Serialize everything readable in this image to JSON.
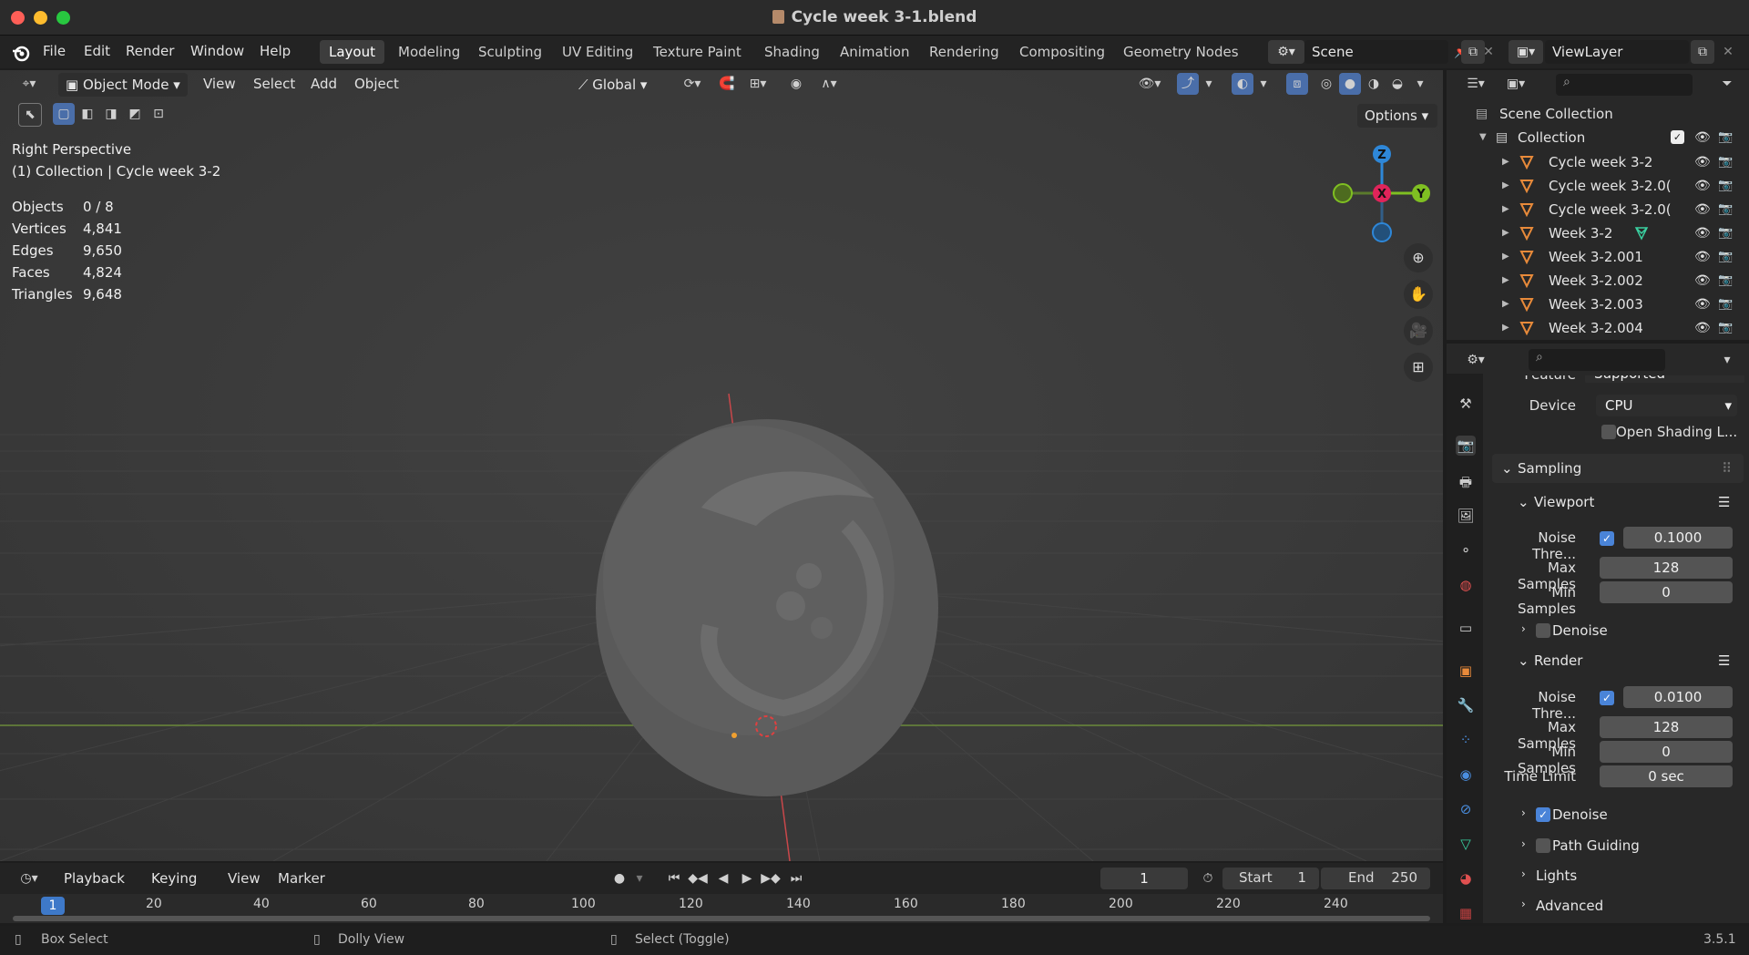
{
  "window": {
    "title": "Cycle week 3-1.blend"
  },
  "menubar": {
    "items": [
      "File",
      "Edit",
      "Render",
      "Window",
      "Help"
    ]
  },
  "workspaces": {
    "tabs": [
      "Layout",
      "Modeling",
      "Sculpting",
      "UV Editing",
      "Texture Paint",
      "Shading",
      "Animation",
      "Rendering",
      "Compositing",
      "Geometry Nodes"
    ],
    "active": "Layout"
  },
  "scene": {
    "name": "Scene",
    "view_layer": "ViewLayer"
  },
  "viewport_header": {
    "mode": "Object Mode",
    "menus": [
      "View",
      "Select",
      "Add",
      "Object"
    ],
    "transform": "Global",
    "options": "Options"
  },
  "overlay": {
    "view_name": "Right Perspective",
    "collection_line": "(1) Collection | Cycle week 3-2"
  },
  "stats": [
    {
      "label": "Objects",
      "value": "0 / 8"
    },
    {
      "label": "Vertices",
      "value": "4,841"
    },
    {
      "label": "Edges",
      "value": "9,650"
    },
    {
      "label": "Faces",
      "value": "4,824"
    },
    {
      "label": "Triangles",
      "value": "9,648"
    }
  ],
  "gizmo": {
    "z": "Z",
    "x": "X",
    "y": "Y"
  },
  "outliner": {
    "scene_collection": "Scene Collection",
    "collection": "Collection",
    "objects": [
      "Cycle week 3-2",
      "Cycle week 3-2.0(",
      "Cycle week 3-2.0(",
      "Week 3-2",
      "Week 3-2.001",
      "Week 3-2.002",
      "Week 3-2.003",
      "Week 3-2.004"
    ]
  },
  "properties": {
    "feature_set_label": "Feature Set",
    "feature_set_value": "Supported",
    "device_label": "Device",
    "device_value": "CPU",
    "open_shading": "Open Shading L...",
    "sampling": "Sampling",
    "viewport": {
      "title": "Viewport",
      "noise_label": "Noise Thre...",
      "noise_value": "0.1000",
      "max_label": "Max Samples",
      "max_value": "128",
      "min_label": "Min Samples",
      "min_value": "0",
      "denoise": "Denoise"
    },
    "render": {
      "title": "Render",
      "noise_label": "Noise Thre...",
      "noise_value": "0.0100",
      "max_label": "Max Samples",
      "max_value": "128",
      "min_label": "Min Samples",
      "min_value": "0",
      "time_label": "Time Limit",
      "time_value": "0 sec",
      "denoise": "Denoise"
    },
    "path_guiding": "Path Guiding",
    "lights": "Lights",
    "advanced": "Advanced"
  },
  "timeline": {
    "menus": [
      "Playback",
      "Keying",
      "View",
      "Marker"
    ],
    "current_frame": "1",
    "start_label": "Start",
    "start_value": "1",
    "end_label": "End",
    "end_value": "250",
    "ticks": [
      "1",
      "20",
      "40",
      "60",
      "80",
      "100",
      "120",
      "140",
      "160",
      "180",
      "200",
      "220",
      "240"
    ]
  },
  "statusbar": {
    "left": "Box Select",
    "middle": "Dolly View",
    "right": "Select (Toggle)",
    "version": "3.5.1"
  }
}
